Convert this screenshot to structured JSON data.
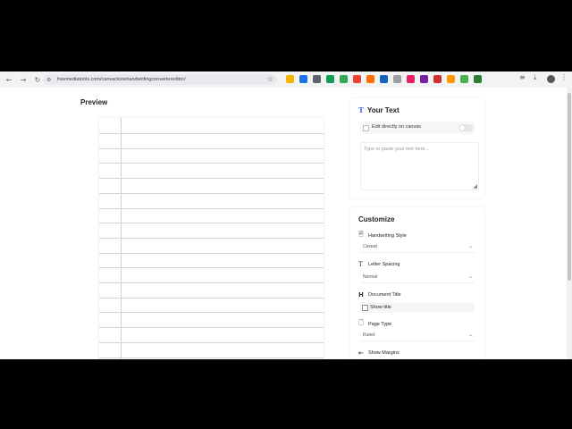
{
  "browser": {
    "url": "freemediatools.com/canvacionehandwritingconvertereditor/",
    "nav_icons": {
      "back": "back-arrow-icon",
      "forward": "forward-arrow-icon",
      "reload": "reload-icon"
    },
    "extension_colors": [
      "#f4b400",
      "#1a73e8",
      "#5f6368",
      "#0f9d58",
      "#34a853",
      "#ea4335",
      "#ff6d00",
      "#1565c0",
      "#9e9e9e",
      "#e91e63",
      "#7b1fa2",
      "#d32f2f",
      "#ff9800",
      "#4caf50",
      "#2e7d32"
    ]
  },
  "preview": {
    "title": "Preview"
  },
  "your_text": {
    "title": "Your Text",
    "edit_toggle_label": "Edit directly on canvas",
    "placeholder": "Type or paste your text here..."
  },
  "customize": {
    "title": "Customize",
    "handwriting_style": {
      "label": "Handwriting Style",
      "value": "Caveat"
    },
    "letter_spacing": {
      "label": "Letter Spacing",
      "value": "Normal"
    },
    "document_title": {
      "label": "Document Title",
      "checkbox_label": "Show title"
    },
    "page_type": {
      "label": "Page Type",
      "value": "Ruled"
    },
    "show_margins": {
      "label": "Show Margins"
    }
  }
}
